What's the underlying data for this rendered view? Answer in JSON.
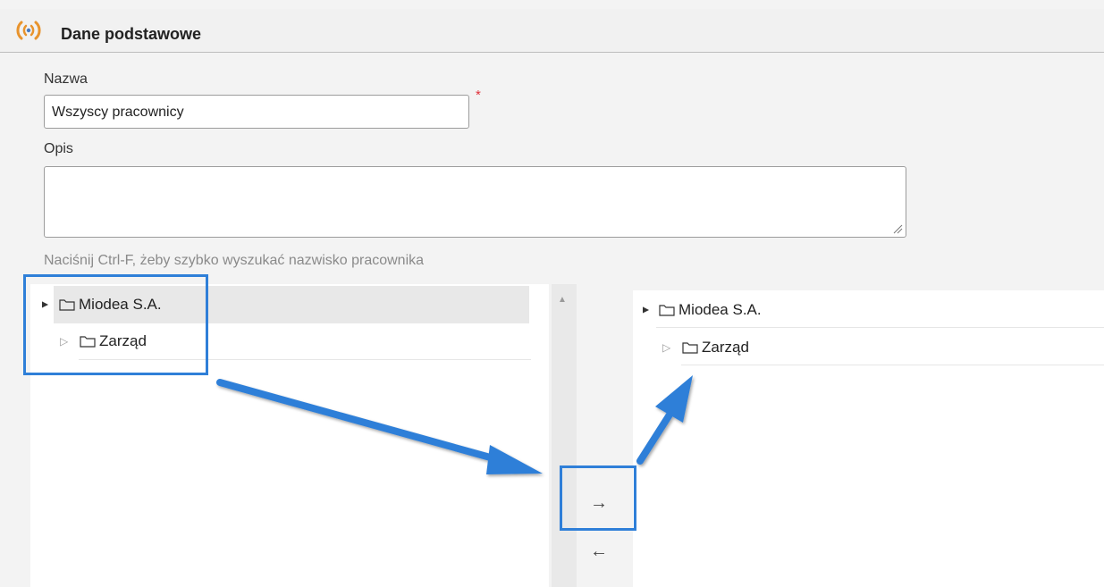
{
  "section": {
    "title": "Dane podstawowe",
    "icon": "signal-waves-icon",
    "icon_color": "#e8932c"
  },
  "form": {
    "name_label": "Nazwa",
    "name_value": "Wszyscy pracownicy",
    "required_mark": "*",
    "description_label": "Opis",
    "description_value": "",
    "hint": "Naciśnij Ctrl-F, żeby szybko wyszukać nazwisko pracownika"
  },
  "left_tree": {
    "items": [
      {
        "label": "Miodea S.A.",
        "expander": "▲",
        "icon": "folder-icon",
        "expanded": true,
        "selected": true
      },
      {
        "label": "Zarząd",
        "expander": "▷",
        "icon": "folder-icon",
        "expanded": false,
        "selected": false
      }
    ]
  },
  "right_tree": {
    "items": [
      {
        "label": "Miodea S.A.",
        "expander": "▲",
        "icon": "folder-icon",
        "expanded": true
      },
      {
        "label": "Zarząd",
        "expander": "▷",
        "icon": "folder-icon",
        "expanded": false
      }
    ]
  },
  "buttons": {
    "move_right": "→",
    "move_left": "←"
  },
  "annotation_color": "#2f7fd8"
}
